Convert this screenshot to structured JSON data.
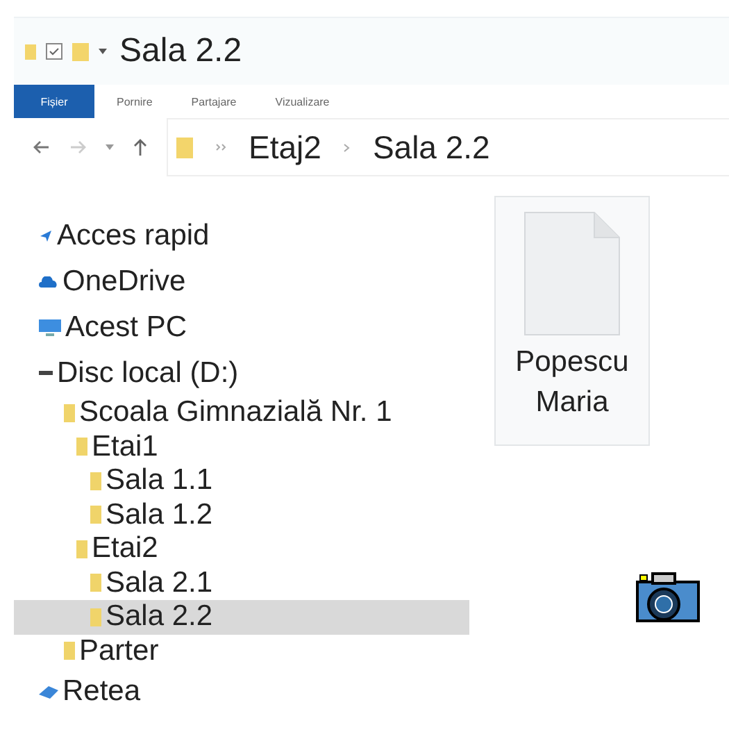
{
  "window": {
    "title": "Sala 2.2"
  },
  "ribbon_tabs": [
    {
      "label": "Fișier",
      "selected": true
    },
    {
      "label": "Pornire",
      "selected": false
    },
    {
      "label": "Partajare",
      "selected": false
    },
    {
      "label": "Vizualizare",
      "selected": false
    }
  ],
  "address_bar": {
    "breadcrumbs": [
      "Etaj2",
      "Sala 2.2"
    ]
  },
  "navigation_tree": [
    {
      "label": "Acces rapid",
      "kind": "quick",
      "selected": false
    },
    {
      "label": "OneDrive",
      "kind": "cloud",
      "selected": false
    },
    {
      "label": "Acest PC",
      "kind": "pc",
      "selected": false
    },
    {
      "label": "Disc local (D:)",
      "kind": "drive",
      "selected": false,
      "children": [
        {
          "label": "Scoala Gimnazială Nr. 1",
          "kind": "folder",
          "selected": false,
          "children": [
            {
              "label": "Etai1",
              "kind": "folder",
              "selected": false,
              "children": [
                {
                  "label": "Sala 1.1",
                  "kind": "folder",
                  "selected": false
                },
                {
                  "label": "Sala 1.2",
                  "kind": "folder",
                  "selected": false
                }
              ]
            },
            {
              "label": "Etai2",
              "kind": "folder",
              "selected": false,
              "children": [
                {
                  "label": "Sala 2.1",
                  "kind": "folder",
                  "selected": false
                },
                {
                  "label": "Sala 2.2",
                  "kind": "folder",
                  "selected": true
                }
              ]
            }
          ]
        },
        {
          "label": "Parter",
          "kind": "folder",
          "selected": false
        }
      ]
    },
    {
      "label": "Retea",
      "kind": "network",
      "selected": false
    }
  ],
  "files": [
    {
      "name": "Popescu Maria"
    }
  ]
}
